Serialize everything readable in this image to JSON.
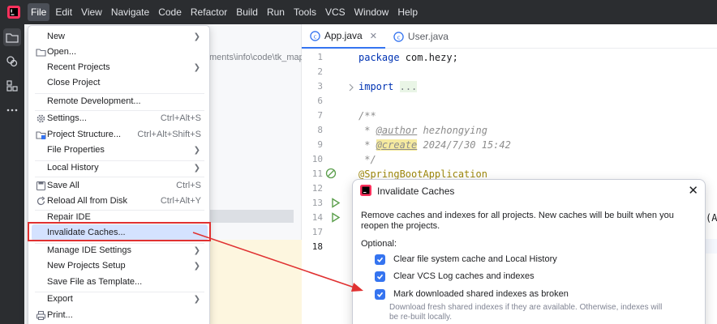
{
  "menubar": {
    "items": [
      "File",
      "Edit",
      "View",
      "Navigate",
      "Code",
      "Refactor",
      "Build",
      "Run",
      "Tools",
      "VCS",
      "Window",
      "Help"
    ],
    "active": "File"
  },
  "project_panel": {
    "path_fragment": "ments\\info\\code\\tk_map"
  },
  "editor": {
    "tabs": [
      {
        "label": "App.java",
        "active": true
      },
      {
        "label": "User.java",
        "active": false
      }
    ],
    "line_numbers": [
      "1",
      "2",
      "3",
      "6",
      "7",
      "8",
      "9",
      "10",
      "11",
      "12",
      "13",
      "14",
      "17",
      "18"
    ],
    "code": {
      "l1_kw": "package",
      "l1_rest": " com.hezy;",
      "l3_kw": "import",
      "l3_fold": "...",
      "l7": "/**",
      "l8_star": " * ",
      "l8_tag": "@author",
      "l8_val": " hezhongying",
      "l9_star": " * ",
      "l9_tag": "@create",
      "l9_val": " 2024/7/30 15:42",
      "l10": " */",
      "l11": "@SpringBootApplication",
      "l14_tail": "(Ap"
    }
  },
  "file_menu": {
    "items": [
      {
        "label": "New",
        "shortcut": "",
        "submenu": true,
        "icon": ""
      },
      {
        "label": "Open...",
        "shortcut": "",
        "submenu": false,
        "icon": "folder-icon"
      },
      {
        "label": "Recent Projects",
        "shortcut": "",
        "submenu": true,
        "icon": ""
      },
      {
        "label": "Close Project",
        "shortcut": "",
        "submenu": false,
        "icon": ""
      },
      {
        "label": "Remote Development...",
        "shortcut": "",
        "submenu": false,
        "icon": ""
      },
      {
        "label": "Settings...",
        "shortcut": "Ctrl+Alt+S",
        "submenu": false,
        "icon": "gear-icon"
      },
      {
        "label": "Project Structure...",
        "shortcut": "Ctrl+Alt+Shift+S",
        "submenu": false,
        "icon": "project-structure-icon"
      },
      {
        "label": "File Properties",
        "shortcut": "",
        "submenu": true,
        "icon": ""
      },
      {
        "label": "Local History",
        "shortcut": "",
        "submenu": true,
        "icon": ""
      },
      {
        "label": "Save All",
        "shortcut": "Ctrl+S",
        "submenu": false,
        "icon": "save-icon"
      },
      {
        "label": "Reload All from Disk",
        "shortcut": "Ctrl+Alt+Y",
        "submenu": false,
        "icon": "reload-icon"
      },
      {
        "label": "Repair IDE",
        "shortcut": "",
        "submenu": false,
        "icon": ""
      },
      {
        "label": "Invalidate Caches...",
        "shortcut": "",
        "submenu": false,
        "icon": ""
      },
      {
        "label": "Manage IDE Settings",
        "shortcut": "",
        "submenu": true,
        "icon": ""
      },
      {
        "label": "New Projects Setup",
        "shortcut": "",
        "submenu": true,
        "icon": ""
      },
      {
        "label": "Save File as Template...",
        "shortcut": "",
        "submenu": false,
        "icon": ""
      },
      {
        "label": "Export",
        "shortcut": "",
        "submenu": true,
        "icon": ""
      },
      {
        "label": "Print...",
        "shortcut": "",
        "submenu": false,
        "icon": "print-icon"
      }
    ],
    "highlighted": "Invalidate Caches..."
  },
  "dialog": {
    "title": "Invalidate Caches",
    "close_glyph": "✕",
    "description": "Remove caches and indexes for all projects. New caches will be built when you reopen the projects.",
    "optional_label": "Optional:",
    "options": [
      {
        "label": "Clear file system cache and Local History",
        "checked": true
      },
      {
        "label": "Clear VCS Log caches and indexes",
        "checked": true
      },
      {
        "label": "Mark downloaded shared indexes as broken",
        "checked": true
      }
    ],
    "hint": "Download fresh shared indexes if they are available. Otherwise, indexes will be re-built locally."
  },
  "colors": {
    "accent": "#3574f0",
    "annotation_arrow": "#e03131",
    "menubar_bg": "#2b2d30"
  }
}
